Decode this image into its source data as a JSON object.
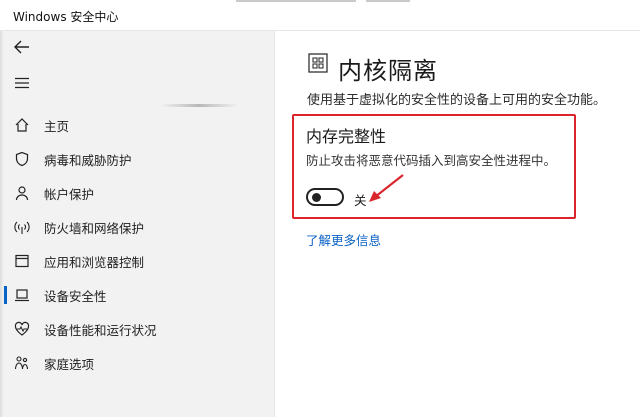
{
  "window": {
    "title": "Windows 安全中心"
  },
  "sidebar": {
    "items": [
      {
        "label": "主页",
        "icon": "home-icon"
      },
      {
        "label": "病毒和威胁防护",
        "icon": "shield-icon"
      },
      {
        "label": "帐户保护",
        "icon": "person-icon"
      },
      {
        "label": "防火墙和网络保护",
        "icon": "wifi-signal-icon"
      },
      {
        "label": "应用和浏览器控制",
        "icon": "app-window-icon"
      },
      {
        "label": "设备安全性",
        "icon": "laptop-icon",
        "active": true
      },
      {
        "label": "设备性能和运行状况",
        "icon": "heart-icon"
      },
      {
        "label": "家庭选项",
        "icon": "family-icon"
      }
    ]
  },
  "main": {
    "title": "内核隔离",
    "title_icon": "core-isolation-icon",
    "description": "使用基于虚拟化的安全性的设备上可用的安全功能。",
    "section": {
      "title": "内存完整性",
      "description": "防止攻击将恶意代码插入到高安全性进程中。",
      "toggle_state": "关"
    },
    "learn_more": "了解更多信息"
  },
  "colors": {
    "accent": "#0a62c6",
    "highlight_border": "#d9252b",
    "sidebar_bg": "#f2f2f2"
  }
}
